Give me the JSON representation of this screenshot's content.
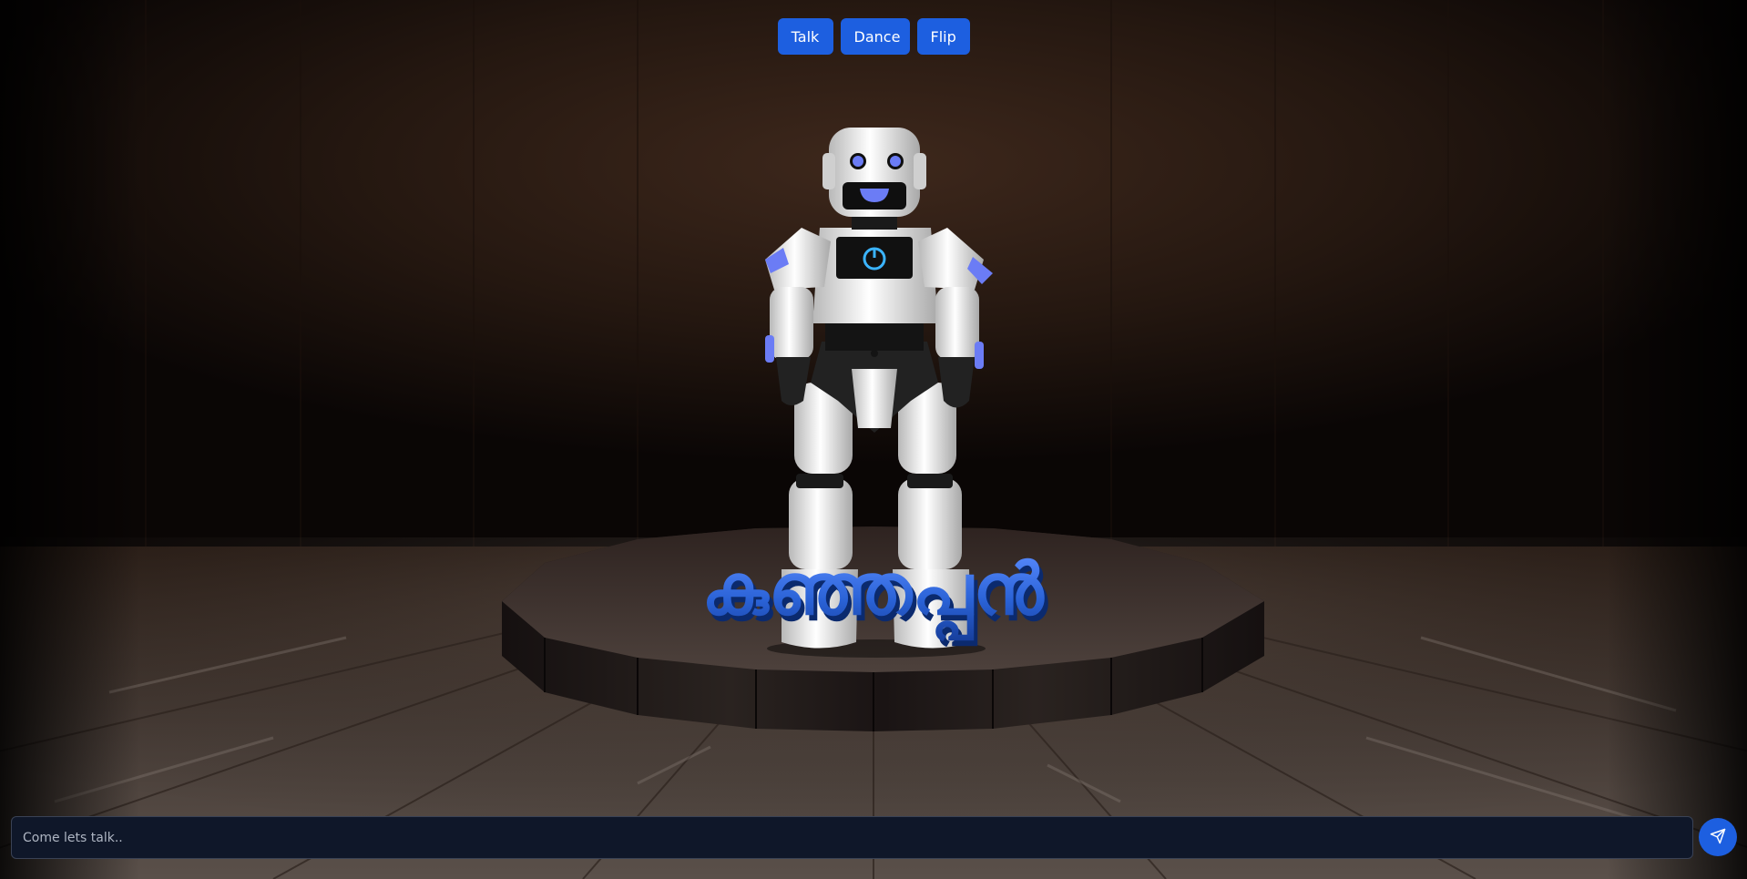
{
  "toolbar": {
    "buttons": [
      {
        "label": "Talk"
      },
      {
        "label": "Dance"
      },
      {
        "label": "Flip"
      }
    ]
  },
  "title_text": "കുഞ്ഞപ്പൻ",
  "chat": {
    "placeholder": "Come lets talk..",
    "value": ""
  },
  "icons": {
    "send": "send-icon"
  },
  "colors": {
    "accent": "#1d5fe0",
    "input_bg": "#0f1729",
    "robot_accent": "#6b7cf5",
    "title_blue": "#2a62d6"
  }
}
